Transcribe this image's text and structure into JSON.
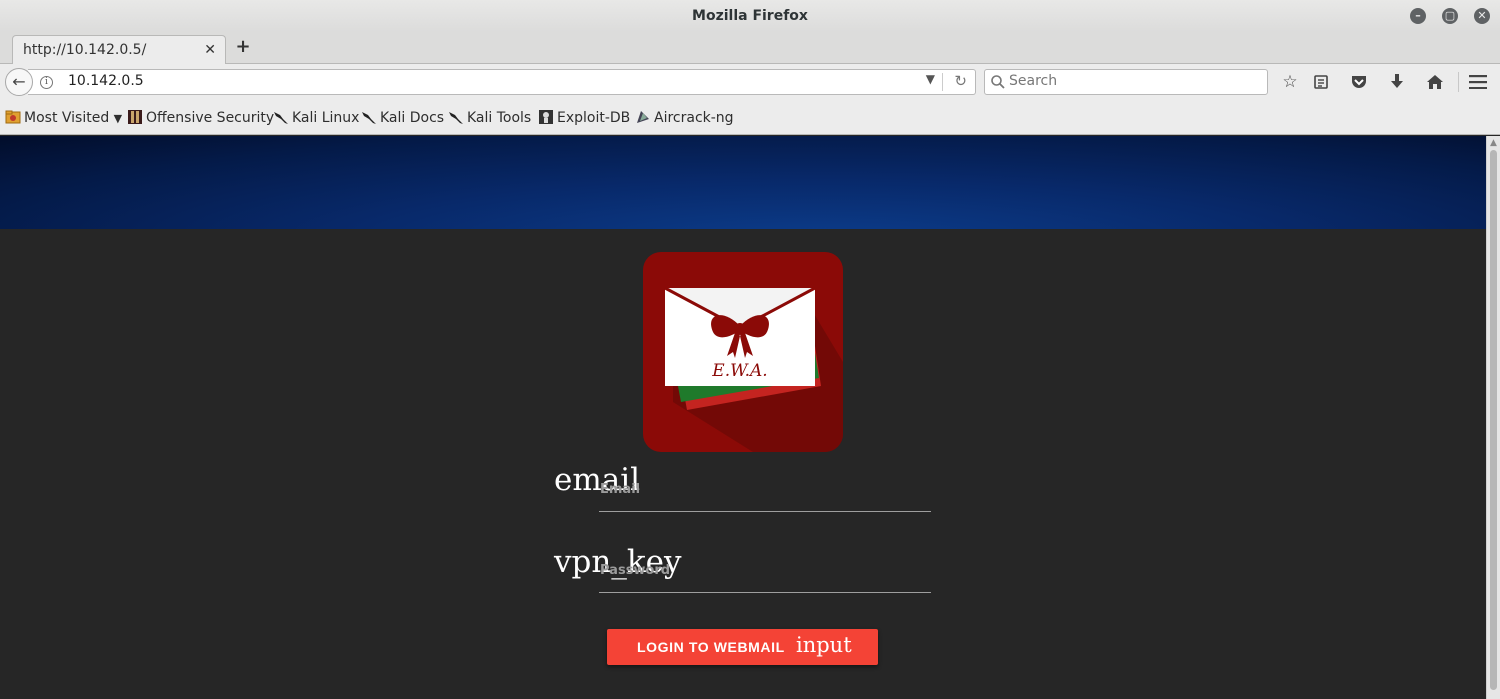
{
  "window": {
    "title": "Mozilla Firefox"
  },
  "tabs": [
    {
      "label": "http://10.142.0.5/",
      "active": true
    }
  ],
  "nav": {
    "url": "10.142.0.5",
    "search_placeholder": "Search"
  },
  "icons": {
    "back": "back-arrow-icon",
    "info": "site-info-icon",
    "reload": "reload-icon",
    "bookmark_star": "star-icon",
    "reader": "clipboard-icon",
    "pocket": "pocket-icon",
    "downloads": "download-icon",
    "home": "home-icon",
    "menu": "hamburger-icon"
  },
  "bookmarks": [
    {
      "label": "Most Visited",
      "dropdown": true,
      "icon": "folder-icon"
    },
    {
      "label": "Offensive Security",
      "icon": "offsec-icon"
    },
    {
      "label": "Kali Linux",
      "icon": "kali-dragon-icon"
    },
    {
      "label": "Kali Docs",
      "icon": "kali-dragon-icon"
    },
    {
      "label": "Kali Tools",
      "icon": "kali-dragon-icon"
    },
    {
      "label": "Exploit-DB",
      "icon": "exploitdb-icon"
    },
    {
      "label": "Aircrack-ng",
      "icon": "aircrack-icon"
    }
  ],
  "page": {
    "logo_text": "E.W.A.",
    "email": {
      "icon_text": "email",
      "label": "Email",
      "value": ""
    },
    "password": {
      "icon_text": "vpn_key",
      "label": "Password",
      "value": ""
    },
    "login": {
      "label": "LOGIN TO WEBMAIL",
      "icon_text": "input"
    }
  },
  "colors": {
    "page_bg": "#262626",
    "banner": "#08296a",
    "logo_bg": "#8b0a07",
    "button": "#f44336"
  }
}
